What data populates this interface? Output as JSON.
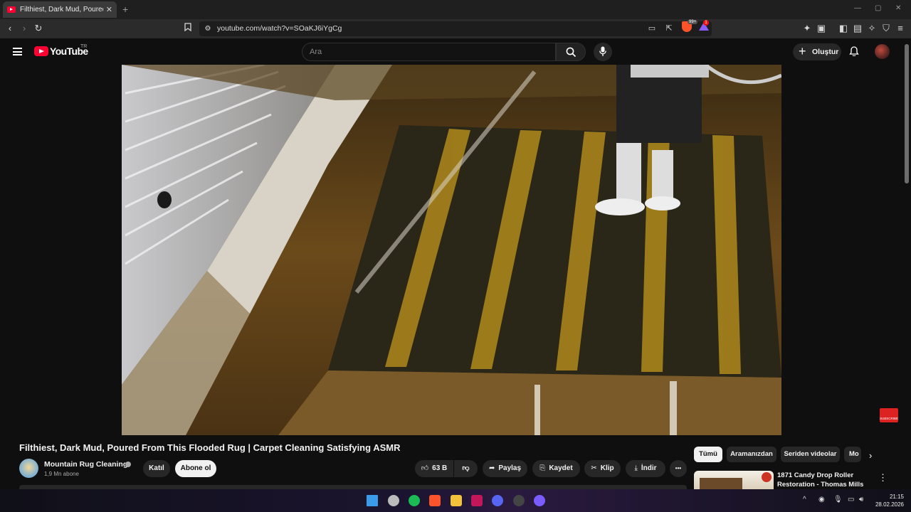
{
  "browser": {
    "tab_title": "Filthiest, Dark Mud, Poured From",
    "url": "youtube.com/watch?v=SOaKJ6iYgCg",
    "shield_count": "99+",
    "rewards_count": "1"
  },
  "header": {
    "logo_text": "YouTube",
    "country_code": "TR",
    "search_placeholder": "Ara",
    "create_label": "Oluştur"
  },
  "video": {
    "title": "Filthiest, Dark Mud, Poured From This Flooded Rug | Carpet Cleaning Satisfying ASMR",
    "watermark": "SUBSCRIBE"
  },
  "channel": {
    "name": "Mountain Rug Cleaning",
    "subscribers": "1,9 Mn abone",
    "join_label": "Katıl",
    "subscribe_label": "Abone ol"
  },
  "actions": {
    "like_count": "63 B",
    "share_label": "Paylaş",
    "save_label": "Kaydet",
    "clip_label": "Klip",
    "download_label": "İndir",
    "more_label": "•••"
  },
  "chips": [
    {
      "label": "Tümü",
      "active": true
    },
    {
      "label": "Aramanızdan",
      "active": false
    },
    {
      "label": "Seriden videolar",
      "active": false
    },
    {
      "label": "Mo",
      "active": false
    }
  ],
  "recommendation": {
    "title": "1871 Candy Drop Roller Restoration - Thomas Mills"
  },
  "taskbar": {
    "time": "21:15",
    "date": "28.02.2026"
  },
  "colors": {
    "accent": "#ff0033",
    "background": "#0f0f0f",
    "button": "#272727"
  }
}
